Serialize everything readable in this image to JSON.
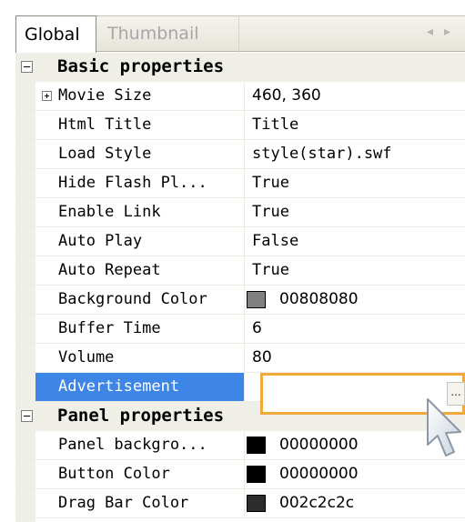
{
  "tabs": [
    {
      "label": "Global",
      "active": true
    },
    {
      "label": "Thumbnail",
      "active": false
    }
  ],
  "tab_arrows": "◂▸",
  "categories": {
    "basic": {
      "label": "Basic properties",
      "expanded": true
    },
    "panel": {
      "label": "Panel properties",
      "expanded": true
    }
  },
  "rows": {
    "movie_size": {
      "name": "Movie Size",
      "value": "460,  360",
      "expandable": true
    },
    "html_title": {
      "name": "Html Title",
      "value": "Title"
    },
    "load_style": {
      "name": "Load Style",
      "value": "style(star).swf"
    },
    "hide_flash": {
      "name": "Hide Flash Pl...",
      "value": "True"
    },
    "enable_link": {
      "name": "Enable Link",
      "value": "True"
    },
    "auto_play": {
      "name": "Auto Play",
      "value": "False"
    },
    "auto_repeat": {
      "name": "Auto Repeat",
      "value": "True"
    },
    "background_color": {
      "name": "Background Color",
      "value": "00808080",
      "swatch": "#808080"
    },
    "buffer_time": {
      "name": "Buffer Time",
      "value": "6"
    },
    "volume": {
      "name": "Volume",
      "value": "80"
    },
    "advertisement": {
      "name": "Advertisement",
      "value": "",
      "selected": true
    },
    "panel_background": {
      "name": "Panel backgro...",
      "value": "00000000",
      "swatch": "#000000"
    },
    "button_color": {
      "name": "Button Color",
      "value": "00000000",
      "swatch": "#000000"
    },
    "drag_bar_color": {
      "name": "Drag Bar Color",
      "value": "002c2c2c",
      "swatch": "#2c2c2c"
    }
  },
  "ellipsis_button": "...",
  "colors": {
    "selection": "#3d86e6",
    "edit_highlight": "#f2a93b",
    "category_bg": "#f0efe7"
  }
}
